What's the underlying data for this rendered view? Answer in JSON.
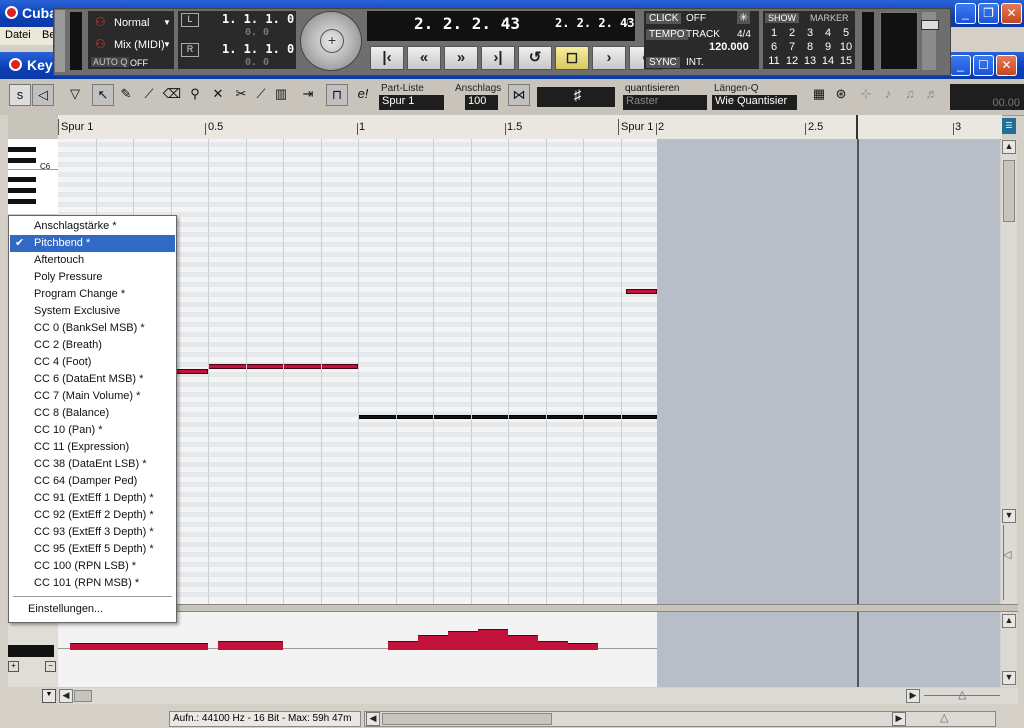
{
  "app": {
    "title": "Cuba",
    "menu": [
      "Datei",
      "Be"
    ],
    "editor_title": "Key"
  },
  "transport": {
    "mode_normal": "Normal",
    "mode_mix": "Mix (MIDI)",
    "autoq": "AUTO Q",
    "autoq_value": "OFF",
    "left_locator": "1. 1. 1.   0",
    "left_sub": "0.   0",
    "right_locator": "1. 1. 1.   0",
    "right_sub": "0.   0",
    "primary_pos": "2. 2. 2. 43",
    "secondary_pos": "2. 2. 2. 43",
    "click_label": "CLICK",
    "click_value": "OFF",
    "tempo_label": "TEMPO",
    "tempo_track": "TRACK",
    "time_signature": "4/4",
    "tempo_value": "120.000",
    "sync_label": "SYNC",
    "sync_value": "INT.",
    "show_label": "SHOW",
    "marker_label": "MARKER",
    "marker_rows": [
      [
        "1",
        "2",
        "3",
        "4",
        "5"
      ],
      [
        "6",
        "7",
        "8",
        "9",
        "10"
      ],
      [
        "11",
        "12",
        "13",
        "14",
        "15"
      ]
    ]
  },
  "toolbar": {
    "part_list_label": "Part-Liste",
    "part_list_value": "Spur 1",
    "velocity_label": "Anschlags",
    "velocity_value": "100",
    "quantize_label": "quantisieren",
    "quantize_value": "Raster",
    "length_label": "Längen-Q",
    "length_value": "Wie Quantisier",
    "position_display": "00.00"
  },
  "ruler": {
    "part_left": "Spur 1",
    "part_right": "Spur 1",
    "ticks": [
      "0.5",
      "1",
      "1.5",
      "2",
      "2.5",
      "3"
    ]
  },
  "keyboard": {
    "c_label": "C6"
  },
  "menu": {
    "items": [
      "Anschlagstärke *",
      "Pitchbend *",
      "Aftertouch",
      "Poly Pressure",
      "Program Change *",
      "System Exclusive",
      "CC 0  (BankSel MSB) *",
      "CC 2  (Breath)",
      "CC 4  (Foot)",
      "CC 6  (DataEnt MSB) *",
      "CC 7  (Main Volume) *",
      "CC 8  (Balance)",
      "CC 10  (Pan) *",
      "CC 11  (Expression)",
      "CC 38  (DataEnt LSB) *",
      "CC 64  (Damper Ped)",
      "CC 91  (ExtEff 1 Depth) *",
      "CC 92  (ExtEff 2 Depth) *",
      "CC 93  (ExtEff 3 Depth) *",
      "CC 95  (ExtEff 5 Depth) *",
      "CC 100  (RPN LSB) *",
      "CC 101  (RPN MSB) *"
    ],
    "settings": "Einstellungen...",
    "selected_index": 1
  },
  "status": {
    "text": "Aufn.: 44100 Hz - 16 Bit - Max: 59h 47m"
  },
  "colors": {
    "note": "#c0123a",
    "selection": "#316ac5",
    "titlebar": "#0a3fb5"
  }
}
